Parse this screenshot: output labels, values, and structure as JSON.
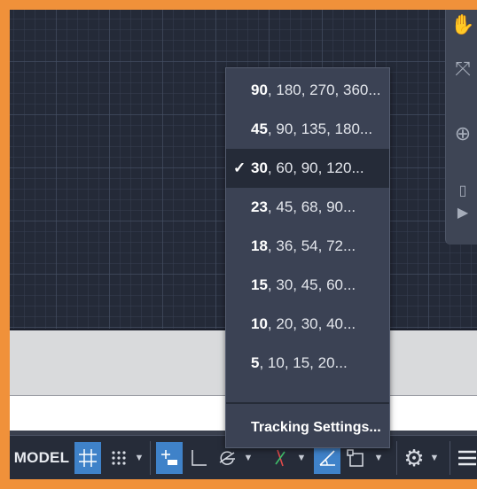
{
  "menu": {
    "items": [
      {
        "lead": "90",
        "rest": ", 180, 270, 360...",
        "selected": false
      },
      {
        "lead": "45",
        "rest": ", 90, 135, 180...",
        "selected": false
      },
      {
        "lead": "30",
        "rest": ", 60, 90, 120...",
        "selected": true
      },
      {
        "lead": "23",
        "rest": ", 45, 68, 90...",
        "selected": false
      },
      {
        "lead": "18",
        "rest": ", 36, 54, 72...",
        "selected": false
      },
      {
        "lead": "15",
        "rest": ", 30, 45, 60...",
        "selected": false
      },
      {
        "lead": "10",
        "rest": ", 20, 30, 40...",
        "selected": false
      },
      {
        "lead": "5",
        "rest": ", 10, 15, 20...",
        "selected": false
      }
    ],
    "check_glyph": "✓",
    "tracking_label": "Tracking Settings..."
  },
  "statusbar": {
    "model_label": "MODEL",
    "icons": [
      "grid-icon",
      "snap-icon",
      "infer-constraints-icon",
      "ortho-icon",
      "polar-tracking-icon",
      "isometric-icon",
      "object-snap-tracking-icon",
      "object-snap-icon",
      "customization-icon",
      "menu-icon"
    ]
  },
  "colors": {
    "frame": "#f0913a",
    "canvas": "#242a38",
    "menu_bg": "#3b4254",
    "menu_selected": "#252b38",
    "active_toggle": "#3f82c9"
  }
}
